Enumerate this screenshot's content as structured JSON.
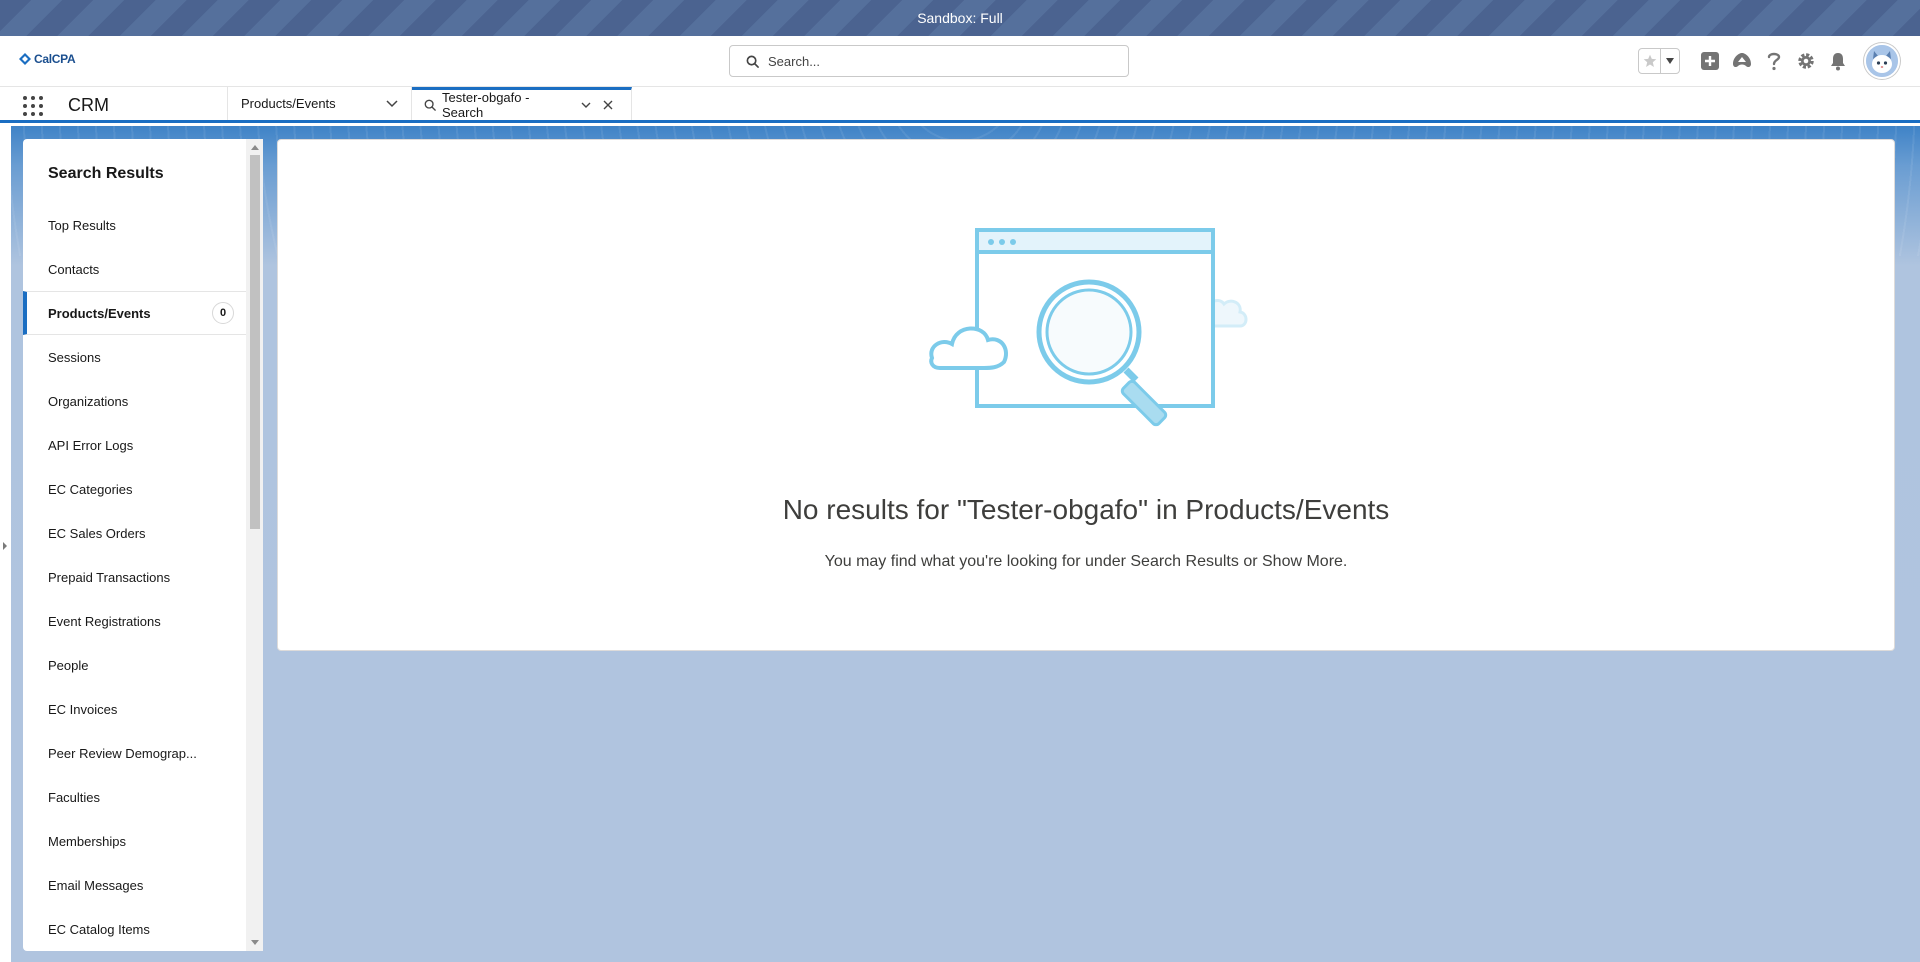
{
  "sandbox_banner": "Sandbox: Full",
  "header": {
    "logo_text": "CalCPA",
    "search_placeholder": "Search..."
  },
  "nav": {
    "app_name": "CRM",
    "nav_item": "Products/Events",
    "active_tab": "Tester-obgafo - Search"
  },
  "sidebar": {
    "title": "Search Results",
    "items": [
      {
        "label": "Top Results"
      },
      {
        "label": "Contacts"
      },
      {
        "label": "Products/Events",
        "count": "0"
      },
      {
        "label": "Sessions"
      },
      {
        "label": "Organizations"
      },
      {
        "label": "API Error Logs"
      },
      {
        "label": "EC Categories"
      },
      {
        "label": "EC Sales Orders"
      },
      {
        "label": "Prepaid Transactions"
      },
      {
        "label": "Event Registrations"
      },
      {
        "label": "People"
      },
      {
        "label": "EC Invoices"
      },
      {
        "label": "Peer Review Demograp..."
      },
      {
        "label": "Faculties"
      },
      {
        "label": "Memberships"
      },
      {
        "label": "Email Messages"
      },
      {
        "label": "EC Catalog Items"
      }
    ]
  },
  "main": {
    "empty_title": "No results for \"Tester-obgafo\" in Products/Events",
    "empty_subtitle": "You may find what you're looking for under Search Results or Show More."
  },
  "colors": {
    "brand_blue": "#1b6ec2",
    "illustration_blue": "#7ccbea",
    "banner": "#4b6390"
  }
}
